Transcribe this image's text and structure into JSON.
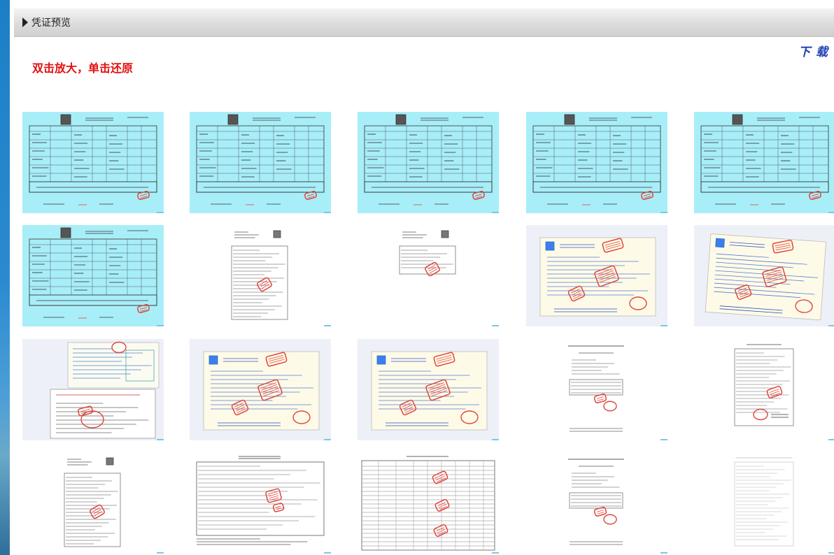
{
  "header": {
    "title": "凭证预览"
  },
  "hint": "双击放大，单击还原",
  "download_label": "下 载",
  "thumbnails": [
    {
      "type": "invoice"
    },
    {
      "type": "invoice"
    },
    {
      "type": "invoice"
    },
    {
      "type": "invoice"
    },
    {
      "type": "invoice"
    },
    {
      "type": "invoice"
    },
    {
      "type": "portrait-table"
    },
    {
      "type": "portrait-sparse"
    },
    {
      "type": "receipt"
    },
    {
      "type": "receipt-tilted"
    },
    {
      "type": "receipt-stack"
    },
    {
      "type": "receipt"
    },
    {
      "type": "receipt"
    },
    {
      "type": "portrait-letter"
    },
    {
      "type": "portrait-form"
    },
    {
      "type": "portrait-table"
    },
    {
      "type": "landscape-form"
    },
    {
      "type": "landscape-table"
    },
    {
      "type": "portrait-letter"
    },
    {
      "type": "portrait-faint"
    }
  ],
  "colors": {
    "invoice_bg": "#a8eef8",
    "stamp": "#e0453b",
    "hint": "#e21111",
    "download": "#1d3fb5"
  }
}
